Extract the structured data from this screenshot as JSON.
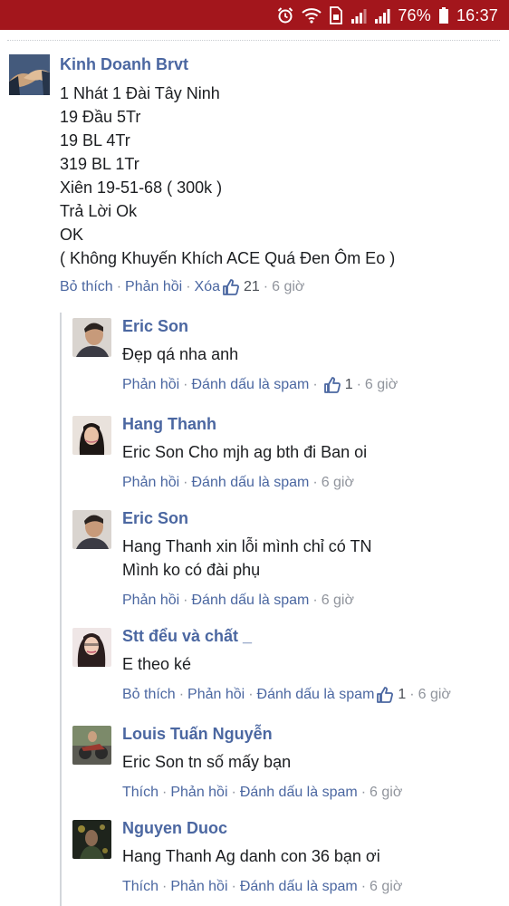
{
  "status_bar": {
    "battery": "76%",
    "time": "16:37",
    "icons": [
      "alarm-icon",
      "wifi-icon",
      "sim-icon",
      "signal-icon",
      "signal-icon",
      "battery-icon"
    ]
  },
  "post": {
    "author": "Kinh Doanh Brvt",
    "avatar": "handshake-avatar",
    "lines": [
      "1 Nhát 1 Đài Tây Ninh",
      "19 Đầu 5Tr",
      "19 BL 4Tr",
      "319 BL 1Tr",
      "Xiên 19-51-68 ( 300k )",
      "Trả Lời Ok",
      "OK",
      "( Không Khuyến Khích ACE Quá Đen Ôm Eo )"
    ],
    "actions": {
      "like": "Bỏ thích",
      "reply": "Phản hồi",
      "delete": "Xóa",
      "like_count": "21",
      "time": "6 giờ"
    }
  },
  "replies": [
    {
      "author": "Eric Son",
      "lines": [
        "Đẹp qá nha anh"
      ],
      "actions": {
        "reply": "Phản hồi",
        "spam": "Đánh dấu là spam",
        "like_count": "1",
        "time": "6 giờ"
      }
    },
    {
      "author": "Hang Thanh",
      "lines": [
        "Eric Son Cho mjh ag bth đi Ban oi"
      ],
      "actions": {
        "reply": "Phản hồi",
        "spam": "Đánh dấu là spam",
        "time": "6 giờ"
      }
    },
    {
      "author": "Eric Son",
      "lines": [
        "Hang Thanh xin lỗi mình chỉ có TN",
        "Mình ko có đài phụ"
      ],
      "actions": {
        "reply": "Phản hồi",
        "spam": "Đánh dấu là spam",
        "time": "6 giờ"
      }
    },
    {
      "author": "Stt đểu và chất _",
      "lines": [
        "E theo ké"
      ],
      "actions": {
        "like": "Bỏ thích",
        "reply": "Phản hồi",
        "spam": "Đánh dấu là spam",
        "like_count": "1",
        "time": "6 giờ"
      }
    },
    {
      "author": "Louis Tuấn Nguyễn",
      "lines": [
        "Eric Son tn số mấy bạn"
      ],
      "actions": {
        "like": "Thích",
        "reply": "Phản hồi",
        "spam": "Đánh dấu là spam",
        "time": "6 giờ"
      }
    },
    {
      "author": "Nguyen Duoc",
      "lines": [
        "Hang Thanh Ag danh con 36 bạn ơi"
      ],
      "actions": {
        "like": "Thích",
        "reply": "Phản hồi",
        "spam": "Đánh dấu là spam",
        "time": "6 giờ"
      }
    }
  ],
  "colors": {
    "status_bar": "#a3161c",
    "link": "#4b67a1",
    "meta": "#90949c",
    "text": "#1c1e21"
  }
}
